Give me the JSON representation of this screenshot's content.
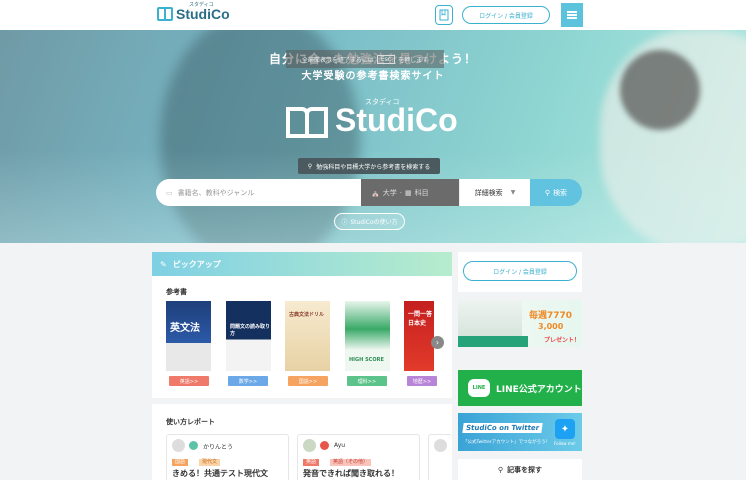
{
  "header": {
    "logo_text": "StudiCo",
    "logo_ruby": "スタディコ",
    "login_label": "ログイン / 会員登録",
    "icons": [
      "bookmark-icon",
      "menu-icon"
    ]
  },
  "hero": {
    "notice_before": "全画面表示を終了するには",
    "notice_key": "Esc",
    "notice_after": "を押します",
    "tagline1": "自分に合った勉強法を見つけよう！",
    "tagline2": "大学受験の参考書検索サイト",
    "big_logo_text": "StudiCo",
    "big_logo_ruby": "スタディコ",
    "search_hint": "勉強科目や目標大学から参考書を検索する",
    "search_placeholder": "書籍名、教科やジャンル",
    "filter_label1": "大学",
    "filter_label2": "科目",
    "detail_label": "詳細検索",
    "search_label": "検索",
    "howto_label": "StudiCoの使い方"
  },
  "pickup": {
    "title": "ピックアップ",
    "subtitle": "参考書",
    "books": [
      {
        "cover_title": "英文法",
        "button": "英語>>",
        "button_color": "#f07a6a"
      },
      {
        "cover_title": "問題文の読み取り方",
        "button": "数学>>",
        "button_color": "#6aa8e8"
      },
      {
        "cover_title": "古典文法ドリル",
        "button": "国語>>",
        "button_color": "#f5a35f"
      },
      {
        "cover_title": "HIGH SCORE",
        "button": "理科>>",
        "button_color": "#5cc38a"
      },
      {
        "cover_title": "一問一答 日本史",
        "button": "地歴>>",
        "button_color": "#b884d8"
      }
    ]
  },
  "reports": {
    "title": "使い方レポート",
    "cards": [
      {
        "user": "かりんとう",
        "tags": [
          "国語",
          "現代文"
        ],
        "title": "きめる！共通テスト現代文"
      },
      {
        "user": "Ayu",
        "tags": [
          "英語",
          "英語（その他）"
        ],
        "title": "発音できれば聞き取れる！"
      }
    ]
  },
  "sidebar": {
    "login_label": "ログイン / 会員登録",
    "banner1_price1": "毎週7770",
    "banner1_price2": "3,000",
    "banner1_present": "プレゼント！",
    "line_badge": "LINE",
    "line_text": "LINE公式アカウント",
    "twitter_title": "StudiCo on Twitter",
    "twitter_sub": "「公式Twitterアカウント」でつながろう！",
    "twitter_follow": "Follow me!",
    "article_label": "記事を探す"
  }
}
